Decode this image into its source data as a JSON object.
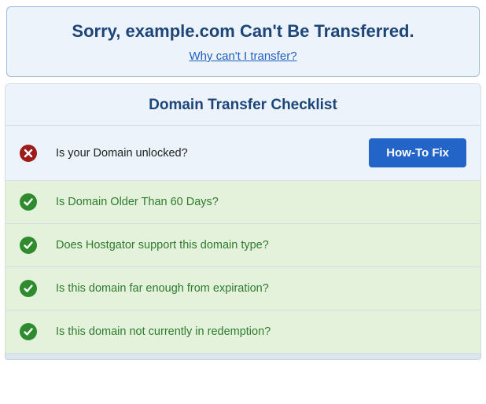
{
  "alert": {
    "title": "Sorry, example.com Can't Be Transferred.",
    "link_text": "Why can't I transfer?"
  },
  "checklist": {
    "title": "Domain Transfer Checklist",
    "fix_button": "How-To Fix",
    "items": [
      {
        "status": "fail",
        "text": "Is your Domain unlocked?"
      },
      {
        "status": "pass",
        "text": "Is Domain Older Than 60 Days?"
      },
      {
        "status": "pass",
        "text": "Does Hostgator support this domain type?"
      },
      {
        "status": "pass",
        "text": "Is this domain far enough from expiration?"
      },
      {
        "status": "pass",
        "text": "Is this domain not currently in redemption?"
      }
    ]
  }
}
